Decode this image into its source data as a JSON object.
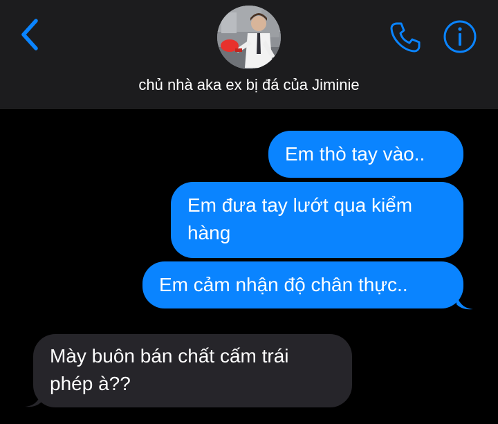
{
  "header": {
    "contact_name": "chủ nhà aka ex bị đá của Jiminie",
    "back_icon": "chevron-left-icon",
    "call_icon": "phone-icon",
    "info_icon": "info-icon",
    "accent_color": "#0a84ff"
  },
  "messages": [
    {
      "direction": "sent",
      "text": "Em thò tay vào.."
    },
    {
      "direction": "sent",
      "text": "Em đưa tay lướt qua kiểm hàng"
    },
    {
      "direction": "sent",
      "text": "Em cảm nhận độ chân thực.."
    },
    {
      "direction": "received",
      "text": "Mày buôn bán chất cấm trái phép à??"
    }
  ],
  "colors": {
    "sent_bubble": "#0a84ff",
    "received_bubble": "#26252a",
    "background": "#000000",
    "header_background": "#1c1c1e"
  }
}
